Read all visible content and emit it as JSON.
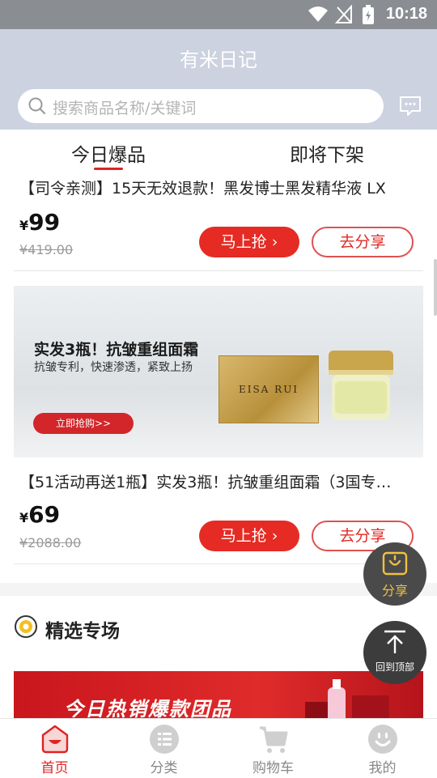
{
  "status_bar": {
    "time": "10:18"
  },
  "header": {
    "title": "有米日记",
    "search_placeholder": "搜索商品名称/关键词"
  },
  "tabs": [
    {
      "label": "今日爆品",
      "active": true
    },
    {
      "label": "即将下架",
      "active": false
    }
  ],
  "products": [
    {
      "title": "【司令亲测】15天无效退款！黑发博士黑发精华液 LX",
      "currency": "¥",
      "price": "99",
      "original_price": "¥419.00",
      "buy_label": "马上抢 ›",
      "share_label": "去分享"
    },
    {
      "banner": {
        "headline": "实发3瓶！抗皱重组面霜",
        "subline": "抗皱专利，快速渗透，紧致上扬",
        "cta": "立即抢购>>",
        "brand": "EISA RUI"
      },
      "title": "【51活动再送1瓶】实发3瓶！抗皱重组面霜（3国专…",
      "currency": "¥",
      "price": "69",
      "original_price": "¥2088.00",
      "buy_label": "马上抢 ›",
      "share_label": "去分享"
    }
  ],
  "section": {
    "title": "精选专场"
  },
  "promo_banner": {
    "text": "今日热销爆款团品"
  },
  "floating": {
    "share_label": "分享",
    "top_label": "回到顶部"
  },
  "bottom_nav": [
    {
      "label": "首页",
      "icon": "home-icon",
      "active": true
    },
    {
      "label": "分类",
      "icon": "category-icon",
      "active": false
    },
    {
      "label": "购物车",
      "icon": "cart-icon",
      "active": false
    },
    {
      "label": "我的",
      "icon": "profile-icon",
      "active": false
    }
  ],
  "colors": {
    "accent": "#e52b24",
    "header_bg": "#cdd2e0",
    "status_bar_bg": "#8a8d92"
  }
}
